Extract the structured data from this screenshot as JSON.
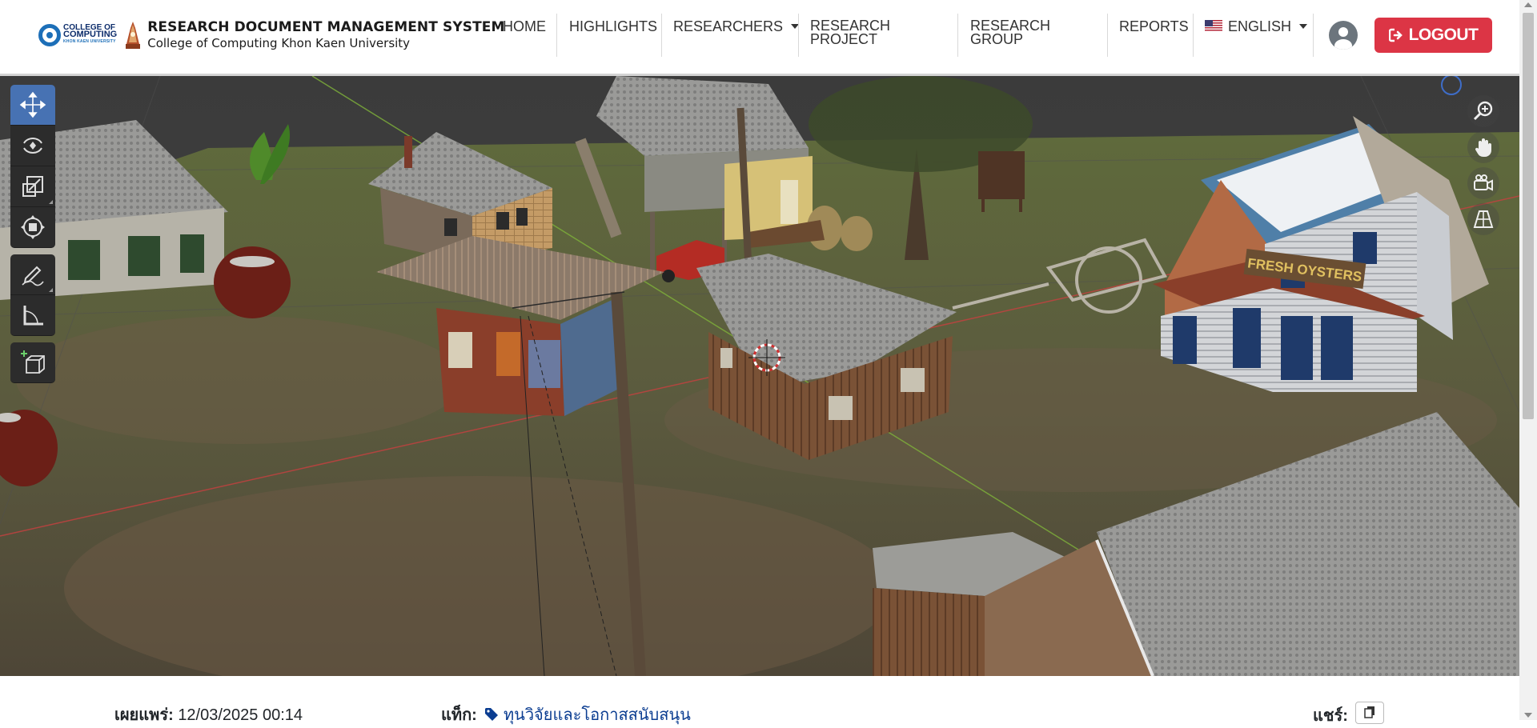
{
  "brand": {
    "logo_line1": "COLLEGE OF",
    "logo_line2": "COMPUTING",
    "logo_line3": "KHON KAEN UNIVERSITY",
    "title": "RESEARCH DOCUMENT MANAGEMENT SYSTEM",
    "subtitle": "College of Computing Khon Kaen University"
  },
  "nav": {
    "home": "HOME",
    "highlights": "HIGHLIGHTS",
    "researchers": "RESEARCHERS",
    "research_project_l1": "RESEARCH",
    "research_project_l2": "PROJECT",
    "research_group_l1": "RESEARCH",
    "research_group_l2": "GROUP",
    "reports": "REPORTS",
    "language": "ENGLISH",
    "logout": "LOGOUT"
  },
  "viewer": {
    "tools": [
      "move-tool",
      "rotate-tool",
      "scale-tool",
      "transform-tool",
      "annotate-tool",
      "measure-tool",
      "add-cube-tool"
    ],
    "active_tool": "move-tool",
    "navigation": [
      "zoom",
      "pan",
      "camera",
      "perspective-grid"
    ],
    "sign_text": "FRESH OYSTERS"
  },
  "meta": {
    "published_label": "เผยแพร่:",
    "published_value": "12/03/2025 00:14",
    "tags_label": "แท็ก:",
    "tag_value": "ทุนวิจัยและโอกาสสนับสนุน",
    "share_label": "แชร์:"
  },
  "colors": {
    "logout": "#dc3545",
    "active_tool": "#4772b3",
    "tag_link": "#0b3d91"
  }
}
